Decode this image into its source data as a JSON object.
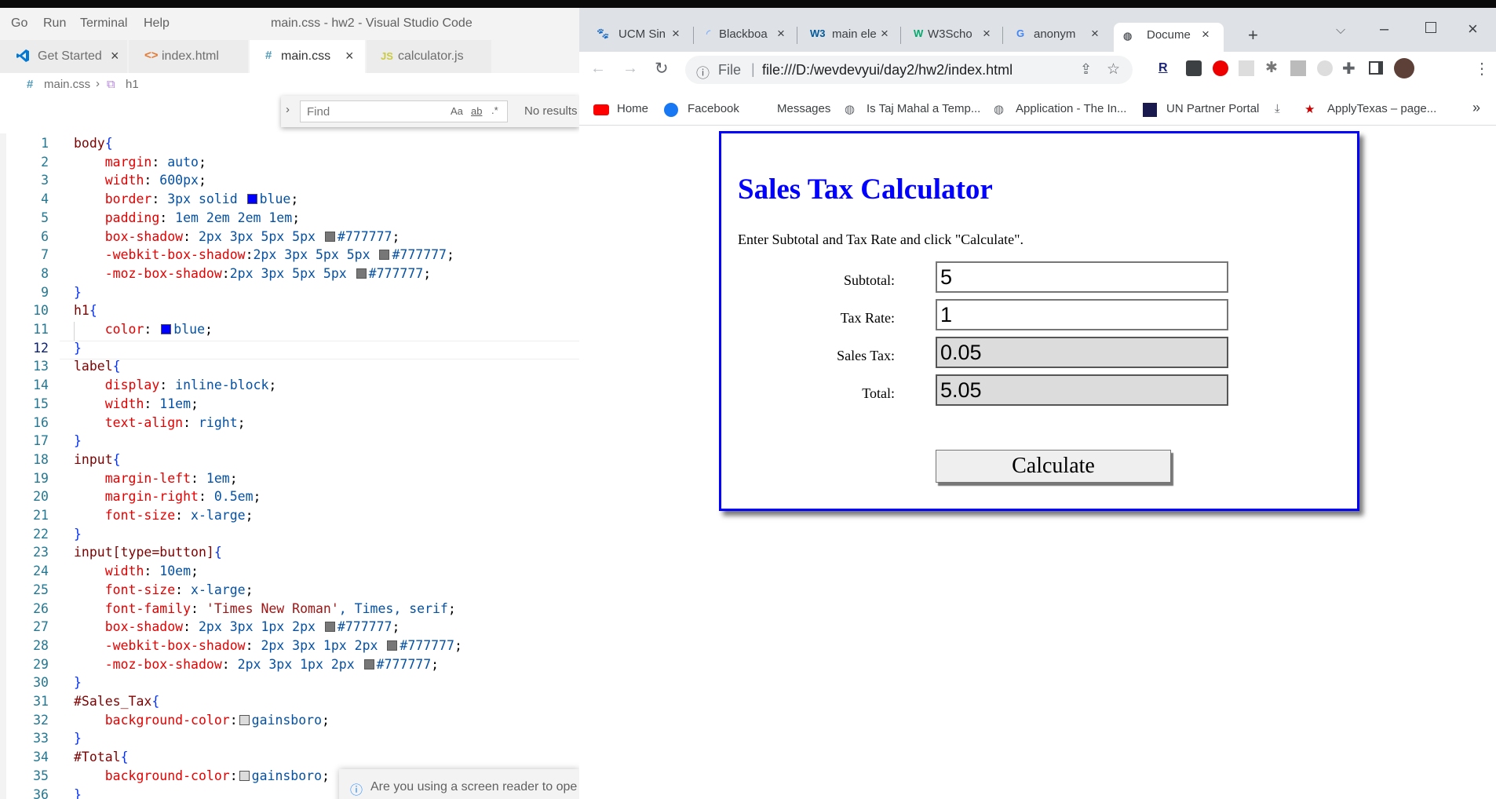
{
  "vscode": {
    "menu": [
      "Go",
      "Run",
      "Terminal",
      "Help"
    ],
    "title": "main.css - hw2 - Visual Studio Code",
    "tabs": [
      {
        "icon": "vscode-logo-icon",
        "label": "Get Started"
      },
      {
        "icon": "<>",
        "label": "index.html"
      },
      {
        "icon": "#",
        "label": "main.css"
      },
      {
        "icon": "JS",
        "label": "calculator.js"
      }
    ],
    "breadcrumb": {
      "file": "main.css",
      "symbol": "h1"
    },
    "find": {
      "placeholder": "Find",
      "opt_case": "Aa",
      "opt_word": "ab",
      "opt_regex": ".*",
      "results": "No results"
    },
    "notification": "Are you using a screen reader to ope",
    "code": [
      "body{",
      "    margin: auto;",
      "    width: 600px;",
      "    border: 3px solid blue;",
      "    padding: 1em 2em 2em 1em;",
      "    box-shadow: 2px 3px 5px 5px #777777;",
      "    -webkit-box-shadow:2px 3px 5px 5px #777777;",
      "    -moz-box-shadow:2px 3px 5px 5px #777777;",
      "}",
      "h1{",
      "    color: blue;",
      "}",
      "label{",
      "    display: inline-block;",
      "    width: 11em;",
      "    text-align: right;",
      "}",
      "input{",
      "    margin-left: 1em;",
      "    margin-right: 0.5em;",
      "    font-size: x-large;",
      "}",
      "input[type=button]{",
      "    width: 10em;",
      "    font-size: x-large;",
      "    font-family: 'Times New Roman', Times, serif;",
      "    box-shadow: 2px 3px 1px 2px #777777;",
      "    -webkit-box-shadow: 2px 3px 1px 2px #777777;",
      "    -moz-box-shadow: 2px 3px 1px 2px #777777;",
      "}",
      "#Sales_Tax{",
      "    background-color:gainsboro;",
      "}",
      "#Total{",
      "    background-color:gainsboro;",
      "}"
    ],
    "current_line": 12
  },
  "chrome": {
    "tabs": [
      {
        "icon": "ucm-icon",
        "title": "UCM Sin"
      },
      {
        "icon": "loading-icon",
        "title": "Blackboa"
      },
      {
        "icon": "w3-icon",
        "title": "main ele"
      },
      {
        "icon": "w3schools-icon",
        "title": "W3Scho"
      },
      {
        "icon": "google-icon",
        "title": "anonym"
      },
      {
        "icon": "globe-icon",
        "title": "Docume"
      }
    ],
    "url_prefix": "File",
    "url": "file:///D:/wevdevyui/day2/hw2/index.html",
    "bookmarks": [
      {
        "icon": "youtube-icon",
        "label": "Home"
      },
      {
        "icon": "facebook-icon",
        "label": "Facebook"
      },
      {
        "icon": "",
        "label": "Messages"
      },
      {
        "icon": "globe-icon",
        "label": "Is Taj Mahal a Temp..."
      },
      {
        "icon": "globe-icon",
        "label": "Application - The In..."
      },
      {
        "icon": "un-icon",
        "label": "UN Partner Portal"
      },
      {
        "icon": "download-icon",
        "label": ""
      },
      {
        "icon": "star-icon",
        "label": "ApplyTexas – page..."
      }
    ]
  },
  "page": {
    "heading": "Sales Tax Calculator",
    "intro": "Enter Subtotal and Tax Rate and click \"Calculate\".",
    "fields": [
      {
        "label": "Subtotal:",
        "value": "5"
      },
      {
        "label": "Tax Rate:",
        "value": "1"
      },
      {
        "label": "Sales Tax:",
        "value": "0.05"
      },
      {
        "label": "Total:",
        "value": "5.05"
      }
    ],
    "button": "Calculate"
  },
  "colors": {
    "heading": "#0000ff",
    "border": "#0000ff",
    "shadow": "#777777",
    "readonly_bg": "#dcdcdc"
  }
}
